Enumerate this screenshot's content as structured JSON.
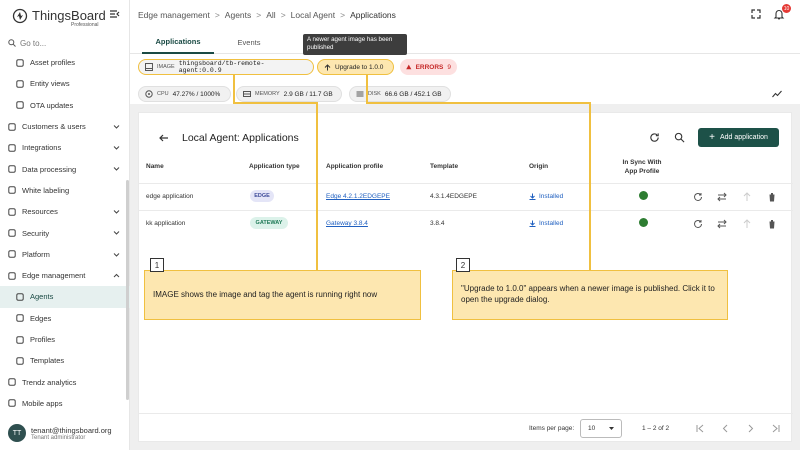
{
  "app": {
    "logo_text": "ThingsBoard",
    "logo_sub": "Professional"
  },
  "sidebar": {
    "goto_placeholder": "Go to...",
    "items": [
      {
        "label": "Asset profiles",
        "type": "sub"
      },
      {
        "label": "Entity views",
        "type": "sub"
      },
      {
        "label": "OTA updates",
        "type": "sub"
      },
      {
        "label": "Customers & users",
        "type": "group"
      },
      {
        "label": "Integrations",
        "type": "group"
      },
      {
        "label": "Data processing",
        "type": "group"
      },
      {
        "label": "White labeling",
        "type": "top"
      },
      {
        "label": "Resources",
        "type": "group"
      },
      {
        "label": "Security",
        "type": "group"
      },
      {
        "label": "Platform",
        "type": "group"
      },
      {
        "label": "Edge management",
        "type": "group-open"
      },
      {
        "label": "Agents",
        "type": "sub-active"
      },
      {
        "label": "Edges",
        "type": "sub"
      },
      {
        "label": "Profiles",
        "type": "sub"
      },
      {
        "label": "Templates",
        "type": "sub"
      },
      {
        "label": "Trendz analytics",
        "type": "top"
      },
      {
        "label": "Mobile apps",
        "type": "top"
      }
    ],
    "user": {
      "initials": "TT",
      "email": "tenant@thingsboard.org",
      "role": "Tenant administrator"
    }
  },
  "header": {
    "breadcrumb": [
      "Edge management",
      "Agents",
      "All",
      "Local Agent",
      "Applications"
    ],
    "notifications_count": "10"
  },
  "tabs": [
    "Applications",
    "Events"
  ],
  "tooltip": "A newer agent image has been published",
  "chips": {
    "image_label": "IMAGE",
    "image_value": "thingsboard/tb-remote-agent:0.0.9",
    "upgrade_label": "Upgrade to 1.0.0",
    "errors_label": "ERRORS",
    "errors_count": "9",
    "cpu_label": "CPU",
    "cpu_value": "47.27% / 1000%",
    "memory_label": "MEMORY",
    "memory_value": "2.9 GB / 11.7 GB",
    "disk_label": "DISK",
    "disk_value": "66.6 GB / 452.1 GB"
  },
  "panel": {
    "title": "Local Agent: Applications",
    "add_button": "Add application",
    "columns": [
      "Name",
      "Application type",
      "Application profile",
      "Template",
      "Origin",
      "In Sync With App Profile"
    ],
    "rows": [
      {
        "name": "edge application",
        "type": "EDGE",
        "profile": "Edge 4.2.1.2EDGEPE",
        "template": "4.3.1.4EDGEPE",
        "origin": "Installed"
      },
      {
        "name": "kk application",
        "type": "GATEWAY",
        "profile": "Gateway 3.8.4",
        "template": "3.8.4",
        "origin": "Installed"
      }
    ],
    "items_per_page_label": "Items per page:",
    "items_per_page": "10",
    "range": "1 – 2 of 2"
  },
  "callouts": [
    {
      "num": "1",
      "text": "IMAGE shows the image and tag the agent is running right now"
    },
    {
      "num": "2",
      "text": "\"Upgrade to 1.0.0\" appears when a newer image is published. Click it to open the upgrade dialog."
    }
  ],
  "colors": {
    "accent": "#1d5148",
    "callout_bg": "#fde7b0",
    "callout_border": "#f0c040",
    "error": "#c62828"
  }
}
